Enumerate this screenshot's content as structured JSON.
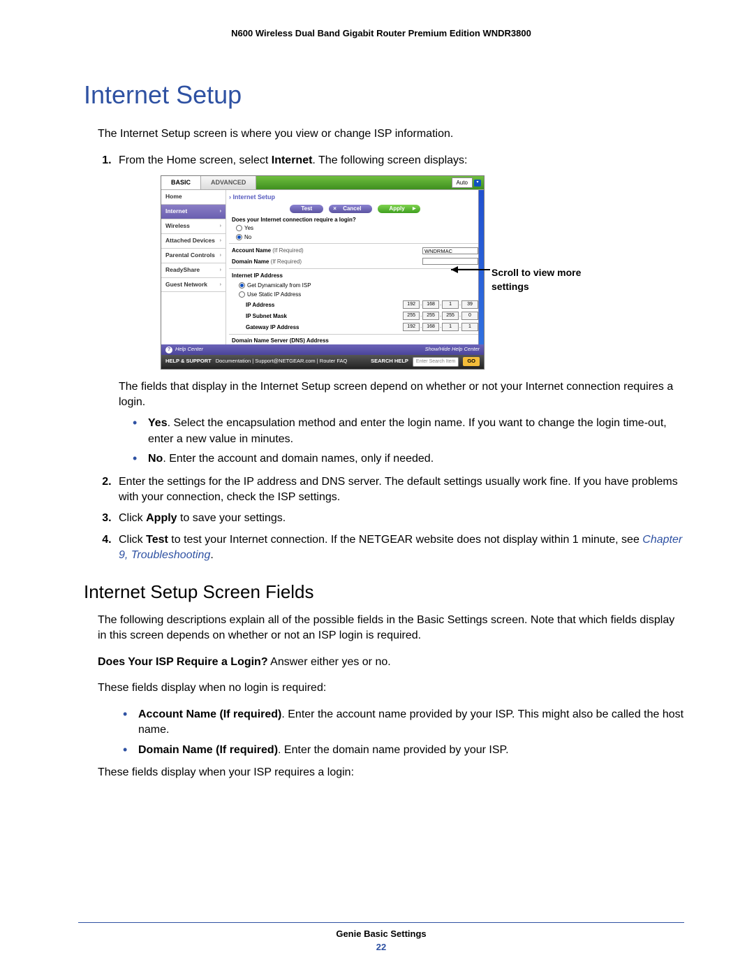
{
  "header": "N600 Wireless Dual Band Gigabit Router Premium Edition WNDR3800",
  "h1": "Internet Setup",
  "intro": "The Internet Setup screen is where you view or change ISP information.",
  "steps": [
    {
      "pre": "From the Home screen, select ",
      "bold": "Internet",
      "post": ". The following screen displays:"
    },
    {
      "text": "Enter the settings for the IP address and DNS server. The default settings usually work fine. If you have problems with your connection, check the ISP settings."
    },
    {
      "pre": "Click ",
      "bold": "Apply",
      "post": " to save your settings."
    },
    {
      "pre": "Click ",
      "bold": "Test",
      "post_a": " to test your Internet connection. If the NETGEAR website does not display within 1 minute, see ",
      "link": "Chapter 9, Troubleshooting",
      "tail": "."
    }
  ],
  "after_ss": "The fields that display in the Internet Setup screen depend on whether or not your Internet connection requires a login.",
  "yn_bullets": [
    {
      "bold": "Yes",
      "rest": ". Select the encapsulation method and enter the login name. If you want to change the login time-out, enter a new value in minutes."
    },
    {
      "bold": "No",
      "rest": ". Enter the account and domain names, only if needed."
    }
  ],
  "h2": "Internet Setup Screen Fields",
  "h2_intro": "The following descriptions explain all of the possible fields in the Basic Settings screen. Note that which fields display in this screen depends on whether or not an ISP login is required.",
  "isp_q": {
    "bold": "Does Your ISP Require a Login?",
    "rest": " Answer either yes or no."
  },
  "no_login_intro": "These fields display when no login is required:",
  "no_login_bullets": [
    {
      "bold": "Account Name (If required)",
      "rest": ". Enter the account name provided by your ISP. This might also be called the host name."
    },
    {
      "bold": "Domain Name (If required)",
      "rest": ". Enter the domain name provided by your ISP."
    }
  ],
  "login_intro": "These fields display when your ISP requires a login:",
  "callout": "Scroll to view more settings",
  "footer": {
    "chapter": "Genie Basic Settings",
    "page": "22"
  },
  "ui": {
    "tabs": {
      "basic": "BASIC",
      "advanced": "ADVANCED"
    },
    "auto": "Auto",
    "sidebar": [
      "Home",
      "Internet",
      "Wireless",
      "Attached Devices",
      "Parental Controls",
      "ReadyShare",
      "Guest Network"
    ],
    "selected_index": 1,
    "breadcrumb": "Internet Setup",
    "buttons": {
      "test": "Test",
      "cancel": "Cancel",
      "apply": "Apply"
    },
    "question": "Does your Internet connection require a login?",
    "yes": "Yes",
    "no": "No",
    "account_label": "Account Name",
    "if_required": "(If Required)",
    "account_value": "WNDRMAC",
    "domain_label": "Domain Name",
    "ip_section": "Internet IP Address",
    "ip_dyn": "Get Dynamically from ISP",
    "ip_static": "Use Static IP Address",
    "ip_fields": {
      "ip": {
        "label": "IP Address",
        "oct": [
          "192",
          "168",
          "1",
          "39"
        ]
      },
      "mask": {
        "label": "IP Subnet Mask",
        "oct": [
          "255",
          "255",
          "255",
          "0"
        ]
      },
      "gateway": {
        "label": "Gateway IP Address",
        "oct": [
          "192",
          "168",
          "1",
          "1"
        ]
      }
    },
    "dns_cut": "Domain Name Server (DNS) Address",
    "help_center": "Help Center",
    "help_toggle": "Show/Hide Help Center",
    "footer_label": "HELP & SUPPORT",
    "footer_links": "Documentation | Support@NETGEAR.com | Router FAQ",
    "search_label": "SEARCH HELP",
    "search_placeholder": "Enter Search Item",
    "go": "GO"
  }
}
